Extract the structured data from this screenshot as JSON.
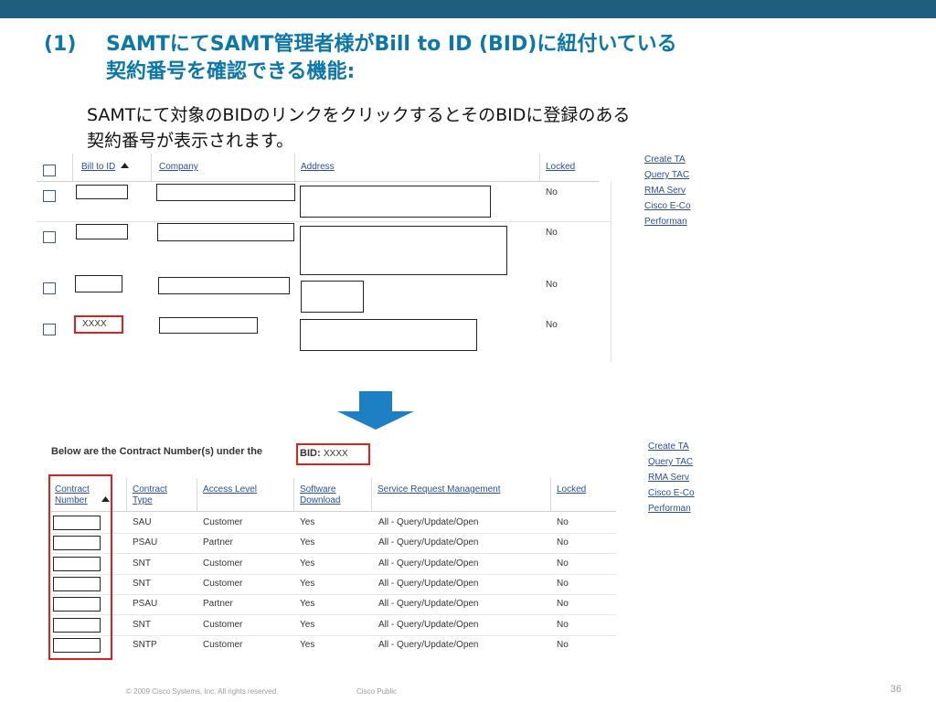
{
  "slide": {
    "title_number": "(1)",
    "title_line1": "SAMTにてSAMT管理者様がBill to ID (BID)に紐付いている",
    "title_line2": "契約番号を確認できる機能:",
    "subtitle_line1": "SAMTにて対象のBIDのリンクをクリックするとそのBIDに登録のある",
    "subtitle_line2": "契約番号が表示されます。",
    "footer_copyright": "© 2009 Cisco Systems, Inc. All rights reserved.",
    "footer_classification": "Cisco Public",
    "page_number": "36"
  },
  "upper_table": {
    "headers": {
      "bill_to_id": "Bill to ID",
      "company": "Company",
      "address": "Address",
      "locked": "Locked"
    },
    "sort_icon": "triangle-up-icon",
    "rows": [
      {
        "locked": "No",
        "bid": ""
      },
      {
        "locked": "No",
        "bid": ""
      },
      {
        "locked": "No",
        "bid": ""
      },
      {
        "locked": "No",
        "bid": "XXXX"
      }
    ]
  },
  "right_links_top": [
    "Create TA",
    "Query TAC",
    "RMA Serv",
    "Cisco E-Co",
    "Performan"
  ],
  "right_links_bottom": [
    "Create TA",
    "Query TAC",
    "RMA Serv",
    "Cisco E-Co",
    "Performan"
  ],
  "lower": {
    "intro": "Below are the Contract Number(s) under the",
    "bid_label": "BID:",
    "bid_value": "XXXX",
    "headers": {
      "contract_number": "Contract Number",
      "contract_type": "Contract Type",
      "access_level": "Access Level",
      "software_download": "Software Download",
      "service_request": "Service Request Management",
      "locked": "Locked"
    },
    "rows": [
      {
        "type": "SAU",
        "access": "Customer",
        "software": "Yes",
        "srm": "All - Query/Update/Open",
        "locked": "No"
      },
      {
        "type": "PSAU",
        "access": "Partner",
        "software": "Yes",
        "srm": "All - Query/Update/Open",
        "locked": "No"
      },
      {
        "type": "SNT",
        "access": "Customer",
        "software": "Yes",
        "srm": "All - Query/Update/Open",
        "locked": "No"
      },
      {
        "type": "SNT",
        "access": "Customer",
        "software": "Yes",
        "srm": "All - Query/Update/Open",
        "locked": "No"
      },
      {
        "type": "PSAU",
        "access": "Partner",
        "software": "Yes",
        "srm": "All - Query/Update/Open",
        "locked": "No"
      },
      {
        "type": "SNT",
        "access": "Customer",
        "software": "Yes",
        "srm": "All - Query/Update/Open",
        "locked": "No"
      },
      {
        "type": "SNTP",
        "access": "Customer",
        "software": "Yes",
        "srm": "All - Query/Update/Open",
        "locked": "No"
      }
    ]
  },
  "colors": {
    "title_blue": "#0e77a9",
    "topbar": "#1e5e7e",
    "highlight_red": "#e02020",
    "arrow_blue": "#1d7fc4",
    "link": "#2b4e9a"
  }
}
